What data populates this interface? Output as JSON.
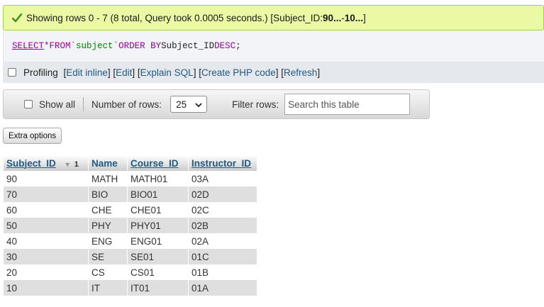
{
  "success": {
    "prefix": "Showing rows 0 - 7 (8 total, Query took 0.0005 seconds.) [Subject_ID: ",
    "range_from": "90...",
    "range_sep": " - ",
    "range_to": "10...",
    "suffix": "]"
  },
  "sql": {
    "select": "SELECT",
    "star": "*",
    "from": "FROM",
    "table": "`subject`",
    "order_by": "ORDER BY",
    "column": "Subject_ID",
    "desc": "DESC",
    "end": ";"
  },
  "profiling": {
    "label": "Profiling",
    "links": [
      "Edit inline",
      "Edit",
      "Explain SQL",
      "Create PHP code",
      "Refresh"
    ]
  },
  "nav": {
    "show_all_label": "Show all",
    "rows_label": "Number of rows:",
    "rows_value": "25",
    "filter_label": "Filter rows:",
    "filter_placeholder": "Search this table"
  },
  "extra_options_label": "Extra options",
  "table": {
    "headers": [
      "Subject_ID",
      "Name",
      "Course_ID",
      "Instructor_ID"
    ],
    "sort_order_number": "1",
    "rows": [
      [
        "90",
        "MATH",
        "MATH01",
        "03A"
      ],
      [
        "70",
        "BIO",
        "BIO01",
        "02D"
      ],
      [
        "60",
        "CHE",
        "CHE01",
        "02C"
      ],
      [
        "50",
        "PHY",
        "PHY01",
        "02B"
      ],
      [
        "40",
        "ENG",
        "ENG01",
        "02A"
      ],
      [
        "30",
        "SE",
        "SE01",
        "01C"
      ],
      [
        "20",
        "CS",
        "CS01",
        "01B"
      ],
      [
        "10",
        "IT",
        "IT01",
        "01A"
      ]
    ]
  },
  "colors": {
    "success_bg": "#ebf8a4",
    "link": "#235a81",
    "sql_keyword": "#990099",
    "sql_string": "#008000"
  },
  "icons": {
    "success": "checkmark-icon",
    "sort": "sort-desc-icon",
    "select_arrow": "chevron-down-icon"
  }
}
